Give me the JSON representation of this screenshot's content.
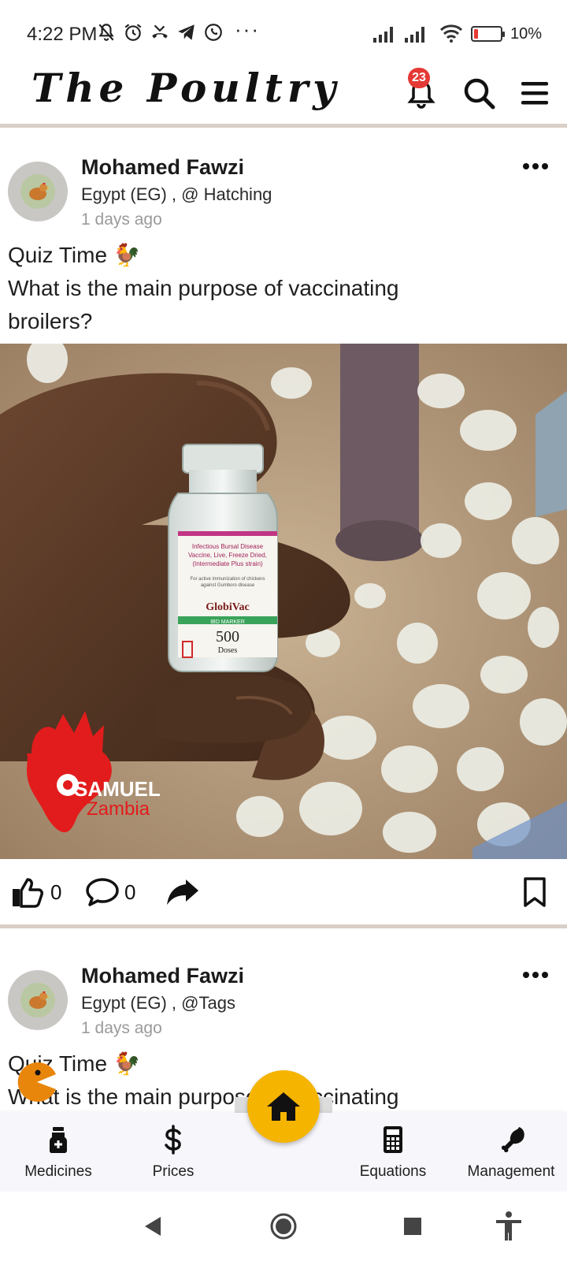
{
  "status_bar": {
    "time": "4:22 PM",
    "more": "···",
    "battery": "10%",
    "icons": [
      "mute-icon",
      "alarm-icon",
      "missed-call-icon",
      "telegram-icon",
      "whatsapp-icon",
      "signal-icon",
      "signal-icon",
      "wifi-icon",
      "battery-icon"
    ]
  },
  "header": {
    "title": "The Poultry",
    "notification_count": "23"
  },
  "posts": [
    {
      "author": "Mohamed Fawzi",
      "location": "Egypt (EG) , @ Hatching",
      "time_ago": "1 days ago",
      "text_lines": [
        "Quiz Time 🐓",
        "What is the main purpose of vaccinating",
        "broilers?"
      ],
      "image": {
        "vial_label": [
          "Infectious Bursal Disease",
          "Vaccine, Live, Freeze Dried,",
          "(Intermediate Plus strain)",
          "For active immunization of chickens",
          "against Gumboro disease"
        ],
        "brand": "GlobiVac",
        "brand_sub": "IBD MARKER",
        "dose_count": "500",
        "dose_unit": "Doses",
        "watermark_line1": "SAMUEL",
        "watermark_line2": "Zambia"
      },
      "likes": "0",
      "comments": "0"
    },
    {
      "author": "Mohamed Fawzi",
      "location": "Egypt (EG) , @Tags",
      "time_ago": "1 days ago",
      "text_lines": [
        "Quiz Time 🐓",
        "What is the main purpose of vaccinating"
      ]
    }
  ],
  "bottom_nav": {
    "items": [
      {
        "label": "Medicines",
        "icon": "medicine-bottle-icon"
      },
      {
        "label": "Prices",
        "icon": "dollar-icon"
      },
      {
        "label": "Equations",
        "icon": "calculator-icon"
      },
      {
        "label": "Management",
        "icon": "chicken-leg-icon"
      }
    ],
    "home_icon": "home-icon",
    "accent_color": "#F5B400"
  },
  "colors": {
    "divider": "#D9CFC7",
    "badge": "#E53935",
    "nav_background": "#F7F6FB"
  }
}
